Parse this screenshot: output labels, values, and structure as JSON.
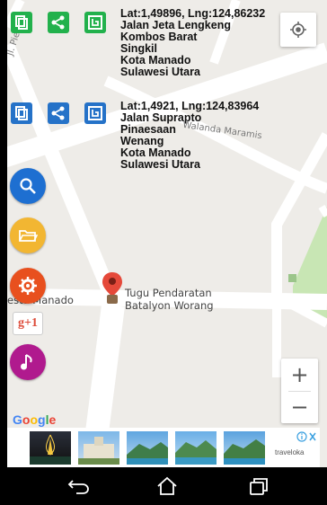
{
  "location1": {
    "coords": "Lat:1,49896, Lng:124,86232",
    "address_lines": [
      "Jalan Jeta Lengkeng",
      "Kombos Barat",
      "Singkil",
      "Kota Manado",
      "Sulawesi Utara"
    ]
  },
  "location2": {
    "coords": "Lat:1,4921, Lng:124,83964",
    "address_lines": [
      "Jalan Suprapto",
      "Pinaesaan",
      "Wenang",
      "Kota Manado",
      "Sulawesi Utara"
    ]
  },
  "map": {
    "street_labels": {
      "pierre": "Jl. Pierre",
      "walanda": "Walanda Maramis",
      "manado": "esta Manado"
    },
    "poi_lines": [
      "Tugu Pendaratan",
      "Batalyon Worang"
    ],
    "google_logo": "Google",
    "zoom_in": "+",
    "zoom_out": "−"
  },
  "gplus_label": "g+1",
  "ad": {
    "brand": "traveloka",
    "icons": [
      "info-icon",
      "close-icon"
    ]
  },
  "icons": {
    "copy": "copy-icon",
    "share": "share-icon",
    "save": "save-icon",
    "search": "search-icon",
    "folder": "folder-icon",
    "settings": "settings-icon",
    "music": "music-icon",
    "locate": "crosshair-icon",
    "pin": "map-pin-icon"
  },
  "colors": {
    "green": "#22b14c",
    "blue": "#2572c8",
    "search_btn": "#1e6fd1",
    "folder_btn": "#f2b632",
    "settings_btn": "#e8501e",
    "music_btn": "#b01a8e",
    "pin": "#e5493a",
    "map_bg": "#eeece8",
    "park": "#c8e6b4"
  },
  "nav": {
    "buttons": [
      "back-icon",
      "home-icon",
      "recent-apps-icon"
    ]
  }
}
